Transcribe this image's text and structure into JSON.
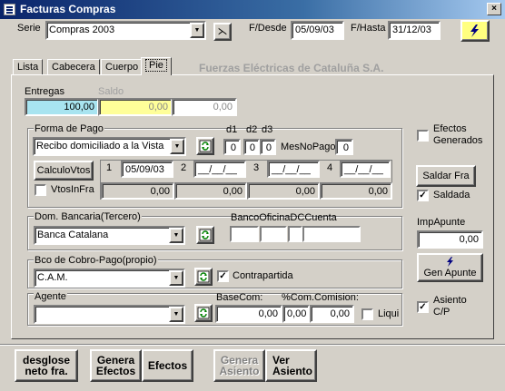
{
  "window": {
    "title": "Facturas Compras",
    "close": "×"
  },
  "header": {
    "serie_label": "Serie",
    "serie_value": "Compras 2003",
    "clear_glyph": "⋋",
    "fdesde_label": "F/Desde",
    "fdesde_value": "05/09/03",
    "fhasta_label": "F/Hasta",
    "fhasta_value": "31/12/03"
  },
  "tabs": [
    {
      "label": "Lista"
    },
    {
      "label": "Cabecera"
    },
    {
      "label": "Cuerpo"
    },
    {
      "label": "Pie"
    }
  ],
  "company": "Fuerzas Eléctricas de Cataluña S.A.",
  "entregas": {
    "label": "Entregas",
    "value": "100,00",
    "saldo_label": "Saldo",
    "saldo_value": "0,00",
    "extra_value": "0,00"
  },
  "forma_pago": {
    "label": "Forma de Pago",
    "value": "Recibo domiciliado a la Vista",
    "d1_label": "d1",
    "d1_value": "0",
    "d2_label": "d2",
    "d2_value": "0",
    "d3_label": "d3",
    "d3_value": "0",
    "mesnopago_label": "MesNoPago",
    "mesnopago_value": "0",
    "calculo_btn": "CalculoVtos",
    "vtosinfra_label": "VtosInFra",
    "vtos": [
      {
        "n": "1",
        "date": "05/09/03",
        "amount": "0,00"
      },
      {
        "n": "2",
        "date": "__/__/__",
        "amount": "0,00"
      },
      {
        "n": "3",
        "date": "__/__/__",
        "amount": "0,00"
      },
      {
        "n": "4",
        "date": "__/__/__",
        "amount": "0,00"
      }
    ]
  },
  "right": {
    "efectos_label1": "Efectos",
    "efectos_label2": "Generados",
    "saldar_btn": "Saldar Fra",
    "saldada_label": "Saldada",
    "impapunte_label": "ImpApunte",
    "impapunte_value": "0,00",
    "gen_apunte_btn": "Gen Apunte",
    "asiento_label1": "Asiento",
    "asiento_label2": "C/P"
  },
  "banco": {
    "dom_label": "Dom. Bancaria(Tercero)",
    "dom_value": "Banca Catalana",
    "cuenta_label": "BancoOficinaDCCuenta"
  },
  "bco_cobro": {
    "label": "Bco de Cobro-Pago(propio)",
    "value": "C.A.M.",
    "contrapartida_label": "Contrapartida"
  },
  "agente": {
    "label": "Agente",
    "value": "",
    "basecom_label": "BaseCom:",
    "basecom_value": "0,00",
    "comision_label": "%Com.Comision:",
    "pct_value": "0,00",
    "comision_value": "0,00",
    "liqui_label": "Liqui"
  },
  "bottom": {
    "desglose_l1": "desglose",
    "desglose_l2": "neto fra.",
    "genera_efectos_l1": "Genera",
    "genera_efectos_l2": "Efectos",
    "efectos": "Efectos",
    "genera_asiento_l1": "Genera",
    "genera_asiento_l2": "Asiento",
    "ver_asiento_l1": "Ver",
    "ver_asiento_l2": "Asiento"
  }
}
